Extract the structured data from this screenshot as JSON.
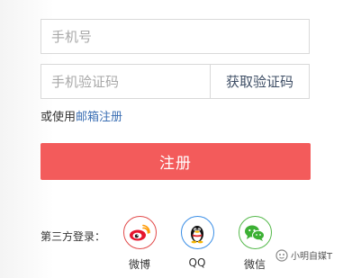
{
  "form": {
    "phone_placeholder": "手机号",
    "code_placeholder": "手机验证码",
    "get_code_label": "获取验证码",
    "alt_prefix": "或使用",
    "alt_link": "邮箱注册",
    "register_label": "注册"
  },
  "third_party": {
    "label": "第三方登录：",
    "items": [
      {
        "name": "微博",
        "icon": "weibo-icon",
        "color": "#e24b4b"
      },
      {
        "name": "QQ",
        "icon": "qq-penguin-icon",
        "color": "#3a8ee6"
      },
      {
        "name": "微信",
        "icon": "wechat-icon",
        "color": "#55b94b"
      }
    ]
  },
  "watermark": {
    "text": "小明自媒T"
  },
  "colors": {
    "primary": "#f35b5b",
    "link": "#3b6fb4"
  }
}
